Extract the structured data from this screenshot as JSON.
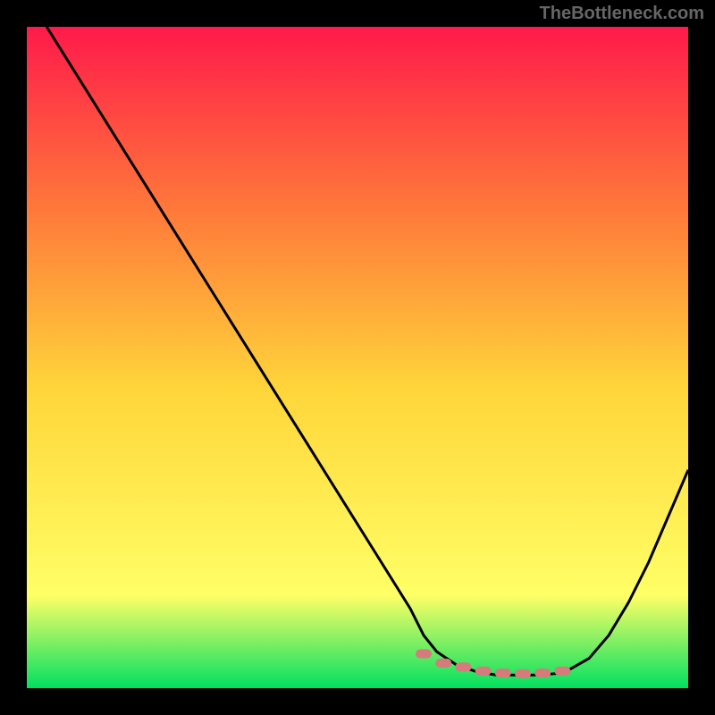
{
  "attribution": "TheBottleneck.com",
  "colors": {
    "background": "#000000",
    "gradient_top": "#ff1a4a",
    "gradient_mid1": "#ff7a3a",
    "gradient_mid2": "#ffd63a",
    "gradient_mid3": "#ffff66",
    "gradient_bottom": "#00e060",
    "curve": "#000000",
    "markers": "#d67b7b"
  },
  "chart_data": {
    "type": "line",
    "title": "",
    "xlabel": "",
    "ylabel": "",
    "xlim": [
      0,
      100
    ],
    "ylim": [
      0,
      100
    ],
    "x": [
      3,
      8,
      13,
      18,
      23,
      28,
      33,
      38,
      43,
      48,
      53,
      58,
      60,
      62,
      65,
      68,
      71,
      74,
      77,
      80,
      82,
      85,
      88,
      91,
      94,
      97,
      100
    ],
    "values": [
      100,
      92,
      84,
      76,
      68,
      60,
      52,
      44,
      36,
      28,
      20,
      12,
      8,
      5.5,
      3.5,
      2.5,
      2,
      2,
      2,
      2.2,
      2.8,
      4.5,
      8,
      13,
      19,
      26,
      33
    ],
    "marker_x": [
      60,
      63,
      66,
      69,
      72,
      75,
      78,
      81
    ],
    "marker_y": [
      5.2,
      3.8,
      3.2,
      2.6,
      2.3,
      2.2,
      2.3,
      2.6
    ],
    "grid": false,
    "legend": false
  }
}
